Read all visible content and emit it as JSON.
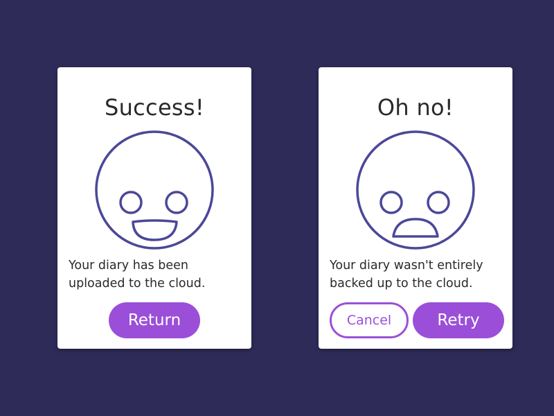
{
  "colors": {
    "background": "#2e2b58",
    "card": "#ffffff",
    "face_stroke": "#4b4898",
    "accent": "#9b4fd8",
    "text": "#2a2a2a"
  },
  "success_card": {
    "title": "Success!",
    "face_icon": "happy-face-icon",
    "message_line1": "Your diary has been",
    "message_line2": "uploaded to the cloud.",
    "return_label": "Return"
  },
  "failure_card": {
    "title": "Oh no!",
    "face_icon": "sad-face-icon",
    "message_line1": "Your diary wasn't entirely",
    "message_line2": "backed up to the cloud.",
    "cancel_label": "Cancel",
    "retry_label": "Retry"
  }
}
